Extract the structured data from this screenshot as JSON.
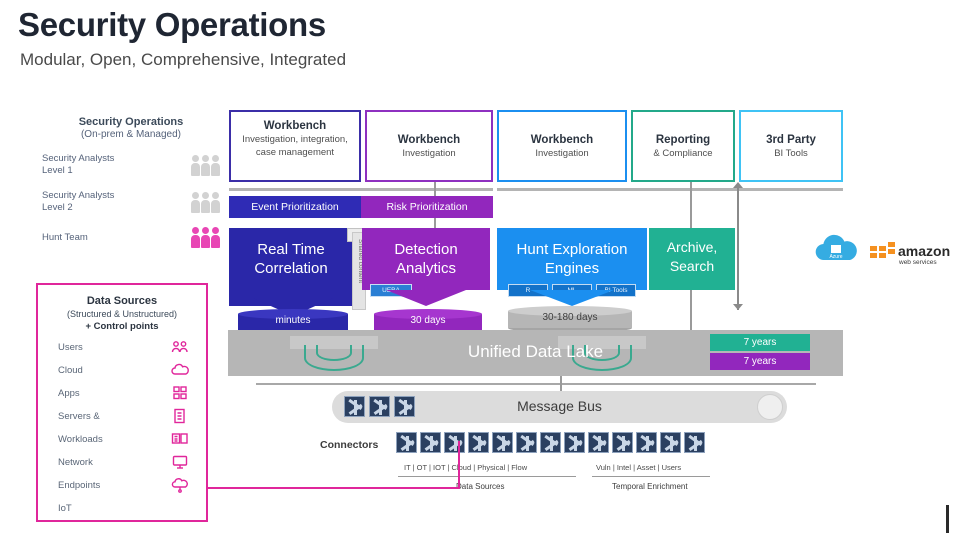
{
  "header": {
    "title": "Security Operations",
    "subtitle": "Modular, Open, Comprehensive, Integrated"
  },
  "secops_legend": {
    "title": "Security Operations",
    "subtitle": "(On-prem & Managed)",
    "rows": [
      {
        "label": "Security Analysts\nLevel 1",
        "line1": "Security Analysts",
        "line2": "Level 1",
        "icon": "people-icon",
        "color": "#d2d2d2"
      },
      {
        "label": "Security Analysts\nLevel 2",
        "line1": "Security Analysts",
        "line2": "Level 2",
        "icon": "people-icon",
        "color": "#d2d2d2"
      },
      {
        "label": "Hunt Team",
        "line1": "Hunt Team",
        "line2": "",
        "icon": "people-icon",
        "color": "#e846b4"
      }
    ]
  },
  "workbenches": [
    {
      "title": "Workbench",
      "subtitle": "Investigation, integration, case management",
      "border": "#3b2ea8"
    },
    {
      "title": "Workbench",
      "subtitle": "Investigation",
      "border": "#8e30c0"
    },
    {
      "title": "Workbench",
      "subtitle": "Investigation",
      "border": "#1b8ff0"
    },
    {
      "title": "Reporting",
      "subtitle": "& Compliance",
      "border": "#23a98a"
    },
    {
      "title": "3rd Party",
      "subtitle": "BI Tools",
      "border": "#3fc3f5"
    }
  ],
  "prioritization": [
    {
      "label": "Event Prioritization",
      "color": "#2f2bb5"
    },
    {
      "label": "Risk Prioritization",
      "color": "#9227bd"
    }
  ],
  "shared_content_label": "Shared content",
  "engines": [
    {
      "name": "Real Time Correlation",
      "line1": "Real Time",
      "line2": "Correlation",
      "color": "#2a27a8",
      "badges": []
    },
    {
      "name": "Detection Analytics",
      "line1": "Detection",
      "line2": "Analytics",
      "color": "#9227bd",
      "badges": [
        "UEBA"
      ]
    },
    {
      "name": "Hunt Exploration Engines",
      "line1": "Hunt Exploration",
      "line2": "Engines",
      "color": "#1b8ff0",
      "badges": [
        "R",
        "ML",
        "BI Tools"
      ]
    },
    {
      "name": "Archive, Search",
      "line1": "Archive,",
      "line2": "Search",
      "color": "#21b193",
      "badges": []
    }
  ],
  "retention": [
    {
      "label": "minutes",
      "color": "#2a27a8"
    },
    {
      "label": "30 days",
      "color": "#9227bd"
    },
    {
      "label": "30-180 days",
      "color": "#b6b6b6"
    }
  ],
  "data_lake": {
    "label": "Unified Data Lake",
    "years_teal": "7 years",
    "years_purple": "7 years",
    "teal_color": "#21b193",
    "purple_color": "#9227bd"
  },
  "message_bus": {
    "label": "Message Bus",
    "icon_count": 3,
    "icon": "connector-icon"
  },
  "connectors": {
    "label": "Connectors",
    "count": 13,
    "icon": "connector-icon",
    "left_group_labels": "IT  |  OT  |  IOT  |  Cloud  |  Physical  | Flow",
    "right_group_labels": "Vuln |  Intel  | Asset  | Users",
    "left_caption": "Data Sources",
    "right_caption": "Temporal Enrichment"
  },
  "data_sources_panel": {
    "title": "Data Sources",
    "subtitle": "(Structured & Unstructured)",
    "subtitle2": "+ Control points",
    "items": [
      {
        "label": "Users",
        "icon": "users-icon"
      },
      {
        "label": "Cloud",
        "icon": "cloud-icon"
      },
      {
        "label": "Apps",
        "icon": "apps-grid-icon"
      },
      {
        "label": "Servers &",
        "icon": "server-document-icon"
      },
      {
        "label": "Workloads",
        "icon": "workload-icon"
      },
      {
        "label": "Network",
        "icon": "monitor-icon"
      },
      {
        "label": "Endpoints",
        "icon": "endpoint-cloud-icon"
      },
      {
        "label": "IoT",
        "icon": ""
      }
    ],
    "accent": "#e0269b"
  },
  "cloud_logos": [
    {
      "name": "azure-logo",
      "label": "Azure",
      "color": "#35ace2"
    },
    {
      "name": "aws-logo",
      "label_main": "amazon",
      "label_sub": "webservices",
      "color": "#f59120"
    }
  ]
}
